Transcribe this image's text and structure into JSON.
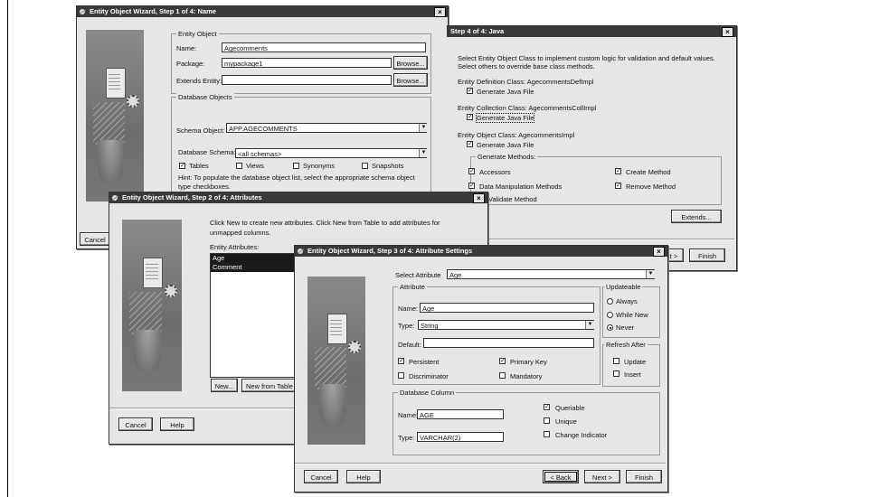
{
  "w1": {
    "title": "Entity Object Wizard, Step 1 of 4: Name",
    "g_entity": "Entity Object",
    "name_label": "Name:",
    "name_value": "Agecomments",
    "package_label": "Package:",
    "package_value": "mypackage1",
    "browse1": "Browse...",
    "extends_label": "Extends Entity:",
    "browse2": "Browse...",
    "g_db": "Database Objects",
    "schema_obj_label": "Schema Object:",
    "schema_obj_value": "APP.AGECOMMENTS",
    "db_schema_label": "Database Schema:",
    "db_schema_value": "<all schemas>",
    "tables": "Tables",
    "views": "Views",
    "synonyms": "Synonyms",
    "snapshots": "Snapshots",
    "hint": "Hint: To populate the database object list, select the appropriate schema object type checkboxes.",
    "cancel": "Cancel"
  },
  "w4": {
    "title": "Step 4 of 4: Java",
    "intro1": "Select Entity Object Class to implement custom logic for validation and default values.",
    "intro2": "Select others to override base class methods.",
    "def_class": "Entity Definition Class: AgecommentsDefImpl",
    "gen1": "Generate Java File",
    "coll_class": "Entity Collection Class: AgecommentsCollImpl",
    "gen2": "Generate Java File",
    "obj_class": "Entity Object Class: AgecommentsImpl",
    "gen3": "Generate Java File",
    "gen_methods": "Generate Methods:",
    "accessors": "Accessors",
    "create_method": "Create Method",
    "dml": "Data Manipulation Methods",
    "remove_method": "Remove Method",
    "validate": "Validate Method",
    "extends_btn": "Extends...",
    "next_partial": "xt >",
    "finish": "Finish"
  },
  "w2": {
    "title": "Entity Object Wizard, Step 2 of 4: Attributes",
    "intro": "Click New to create new attributes.  Click New from Table to add attributes for unmapped columns.",
    "attrs_label": "Entity Attributes:",
    "attrs": [
      "Age",
      "Comment"
    ],
    "new_btn": "New...",
    "new_table_btn": "New from Table",
    "cancel": "Cancel",
    "help": "Help"
  },
  "w3": {
    "title": "Entity Object Wizard, Step 3 of 4: Attribute Settings",
    "select_label": "Select Attribute",
    "select_value": "Age",
    "g_attr": "Attribute",
    "name_label": "Name:",
    "name_value": "Age",
    "type_label": "Type:",
    "type_value": "String",
    "default_label": "Default:",
    "persistent": "Persistent",
    "primary_key": "Primary Key",
    "discriminator": "Discriminator",
    "mandatory": "Mandatory",
    "g_upd": "Updateable",
    "always": "Always",
    "while_new": "While New",
    "never": "Never",
    "g_refresh": "Refresh After",
    "update": "Update",
    "insert": "Insert",
    "g_dbcol": "Database Column",
    "col_name_label": "Name:",
    "col_name_value": "AGE",
    "col_type_label": "Type:",
    "col_type_value": "VARCHAR(2)",
    "queriable": "Queriable",
    "unique": "Unique",
    "change_ind": "Change Indicator",
    "cancel": "Cancel",
    "help": "Help",
    "back": "< Back",
    "next": "Next >",
    "finish": "Finish"
  }
}
